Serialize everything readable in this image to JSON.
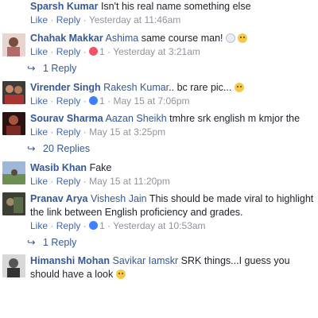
{
  "comments": [
    {
      "author": "Sparsh Kumar",
      "mention": "",
      "text": "Isn't his real name something else",
      "like": "Like",
      "reply": "Reply",
      "reactions": "",
      "time": "Yesterday at 11:46am",
      "avatar_color": "#6b7a55"
    },
    {
      "author": "Chahak Makkar",
      "mention": "Ashima",
      "text": "same course man!",
      "like": "Like",
      "reply": "Reply",
      "reactions": "1",
      "reaction_icon": "love-icon",
      "time": "Yesterday at 3:21am",
      "avatar_color": "#c9a7a0",
      "replies": "1 Reply"
    },
    {
      "author": "Virender Singh",
      "mention": "Rakesh Kumar",
      "text": ".. bc rare pic...",
      "like": "Like",
      "reply": "Reply",
      "reactions": "1",
      "reaction_icon": "like-icon",
      "time": "May 15 at 7:06pm",
      "avatar_color": "#3e3a3a"
    },
    {
      "author": "Sourav Sharma",
      "mention": "Aazan Sheikh",
      "text": "tmhre srk english m kmjor the",
      "like": "Like",
      "reply": "Reply",
      "reactions": "",
      "time": "May 15 at 3:25pm",
      "avatar_color": "#7a2a22",
      "replies": "20 Replies"
    },
    {
      "author": "Wasib Khan",
      "mention": "",
      "text": "Fake",
      "like": "Like",
      "reply": "Reply",
      "reactions": "",
      "time": "May 15 at 11:20pm",
      "avatar_color": "#7fa07a"
    },
    {
      "author": "Pranav Arya",
      "mention": "Vishesh Jain",
      "text": "This should be made viral to highlight the link between English proficiency and grades.",
      "like": "Like",
      "reply": "Reply",
      "reactions": "1",
      "reaction_icon": "like-icon",
      "time": "Yesterday at 10:53am",
      "avatar_color": "#4a4f3c",
      "replies": "1 Reply"
    },
    {
      "author": "Himanshi Mohan",
      "mention": "Savikar Iamskr",
      "text": "SRK things...I guess you should have a look",
      "like": "",
      "reply": "",
      "reactions": "",
      "time": "",
      "avatar_color": "#777777"
    }
  ],
  "colors": {
    "author": "#365899",
    "link": "#4267b2",
    "meta": "#90949c",
    "text": "#1d2129",
    "love": "#f25268",
    "like": "#4080ff"
  },
  "separator": "·",
  "reply_arrow_icon": "reply-arrow-icon"
}
